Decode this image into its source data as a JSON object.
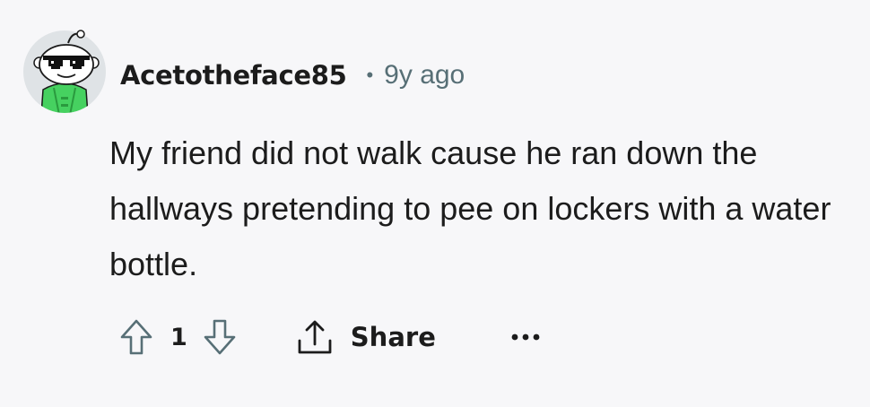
{
  "comment": {
    "author": "Acetotheface85",
    "separator": "•",
    "timestamp": "9y ago",
    "body": "My friend did not walk cause he ran down the hallways pretending to pee on lockers with a water bottle.",
    "avatar_icon": "snoo-avatar-sunglasses",
    "actions": {
      "upvote_icon": "upvote-arrow-icon",
      "score": "1",
      "downvote_icon": "downvote-arrow-icon",
      "share_icon": "share-icon",
      "share_label": "Share",
      "more_icon": "more-options-icon"
    }
  },
  "colors": {
    "background": "#f7f7f9",
    "text_primary": "#1c1c1c",
    "text_secondary": "#576f76",
    "avatar_outfit": "#46d160"
  }
}
